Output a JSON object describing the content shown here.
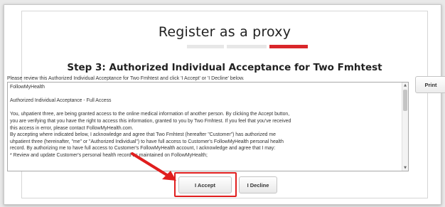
{
  "page": {
    "title": "Register as a proxy",
    "subtitle": "Step 3: Authorized Individual Acceptance for Two Fmhtest",
    "instructions": "Please review this Authorized Individual Acceptance for Two Fmhtest and click 'I Accept' or 'I Decline' below."
  },
  "progress": {
    "total_steps": 3,
    "current_step": 3,
    "colors": {
      "done": "#e7e7e7",
      "current": "#d9262a"
    }
  },
  "document": {
    "lines": [
      "FollowMyHealth",
      "",
      "Authorized Individual Acceptance - Full Access",
      "",
      "You, uhpatient three, are being granted access to the online medical information of another person.  By clicking the Accept button,",
      "you are verifying that you have the right to access this information, granted to you by Two Fmhtest.  If you feel that you've received",
      "this access in error, please contact FollowMyHealth.com.",
      "By accepting where indicated below, I acknowledge and agree that Two Fmhtest (hereafter \"Customer\") has authorized me",
      "uhpatient three (hereinafter, \"me\" or \"Authorized Individual\") to have full access to Customer's FollowMyHealth personal health",
      "record.  By authorizing me to have full access to Customer's FollowMyHealth account,  I acknowledge and agree that I may:",
      "*      Review and update Customer's personal health record as maintained on FollowMyHealth;"
    ]
  },
  "buttons": {
    "print": "Print",
    "accept": "I Accept",
    "decline": "I Decline"
  },
  "annotation": {
    "color": "#e01e1e",
    "arrow_icon": "arrow-pointing-to-accept"
  }
}
